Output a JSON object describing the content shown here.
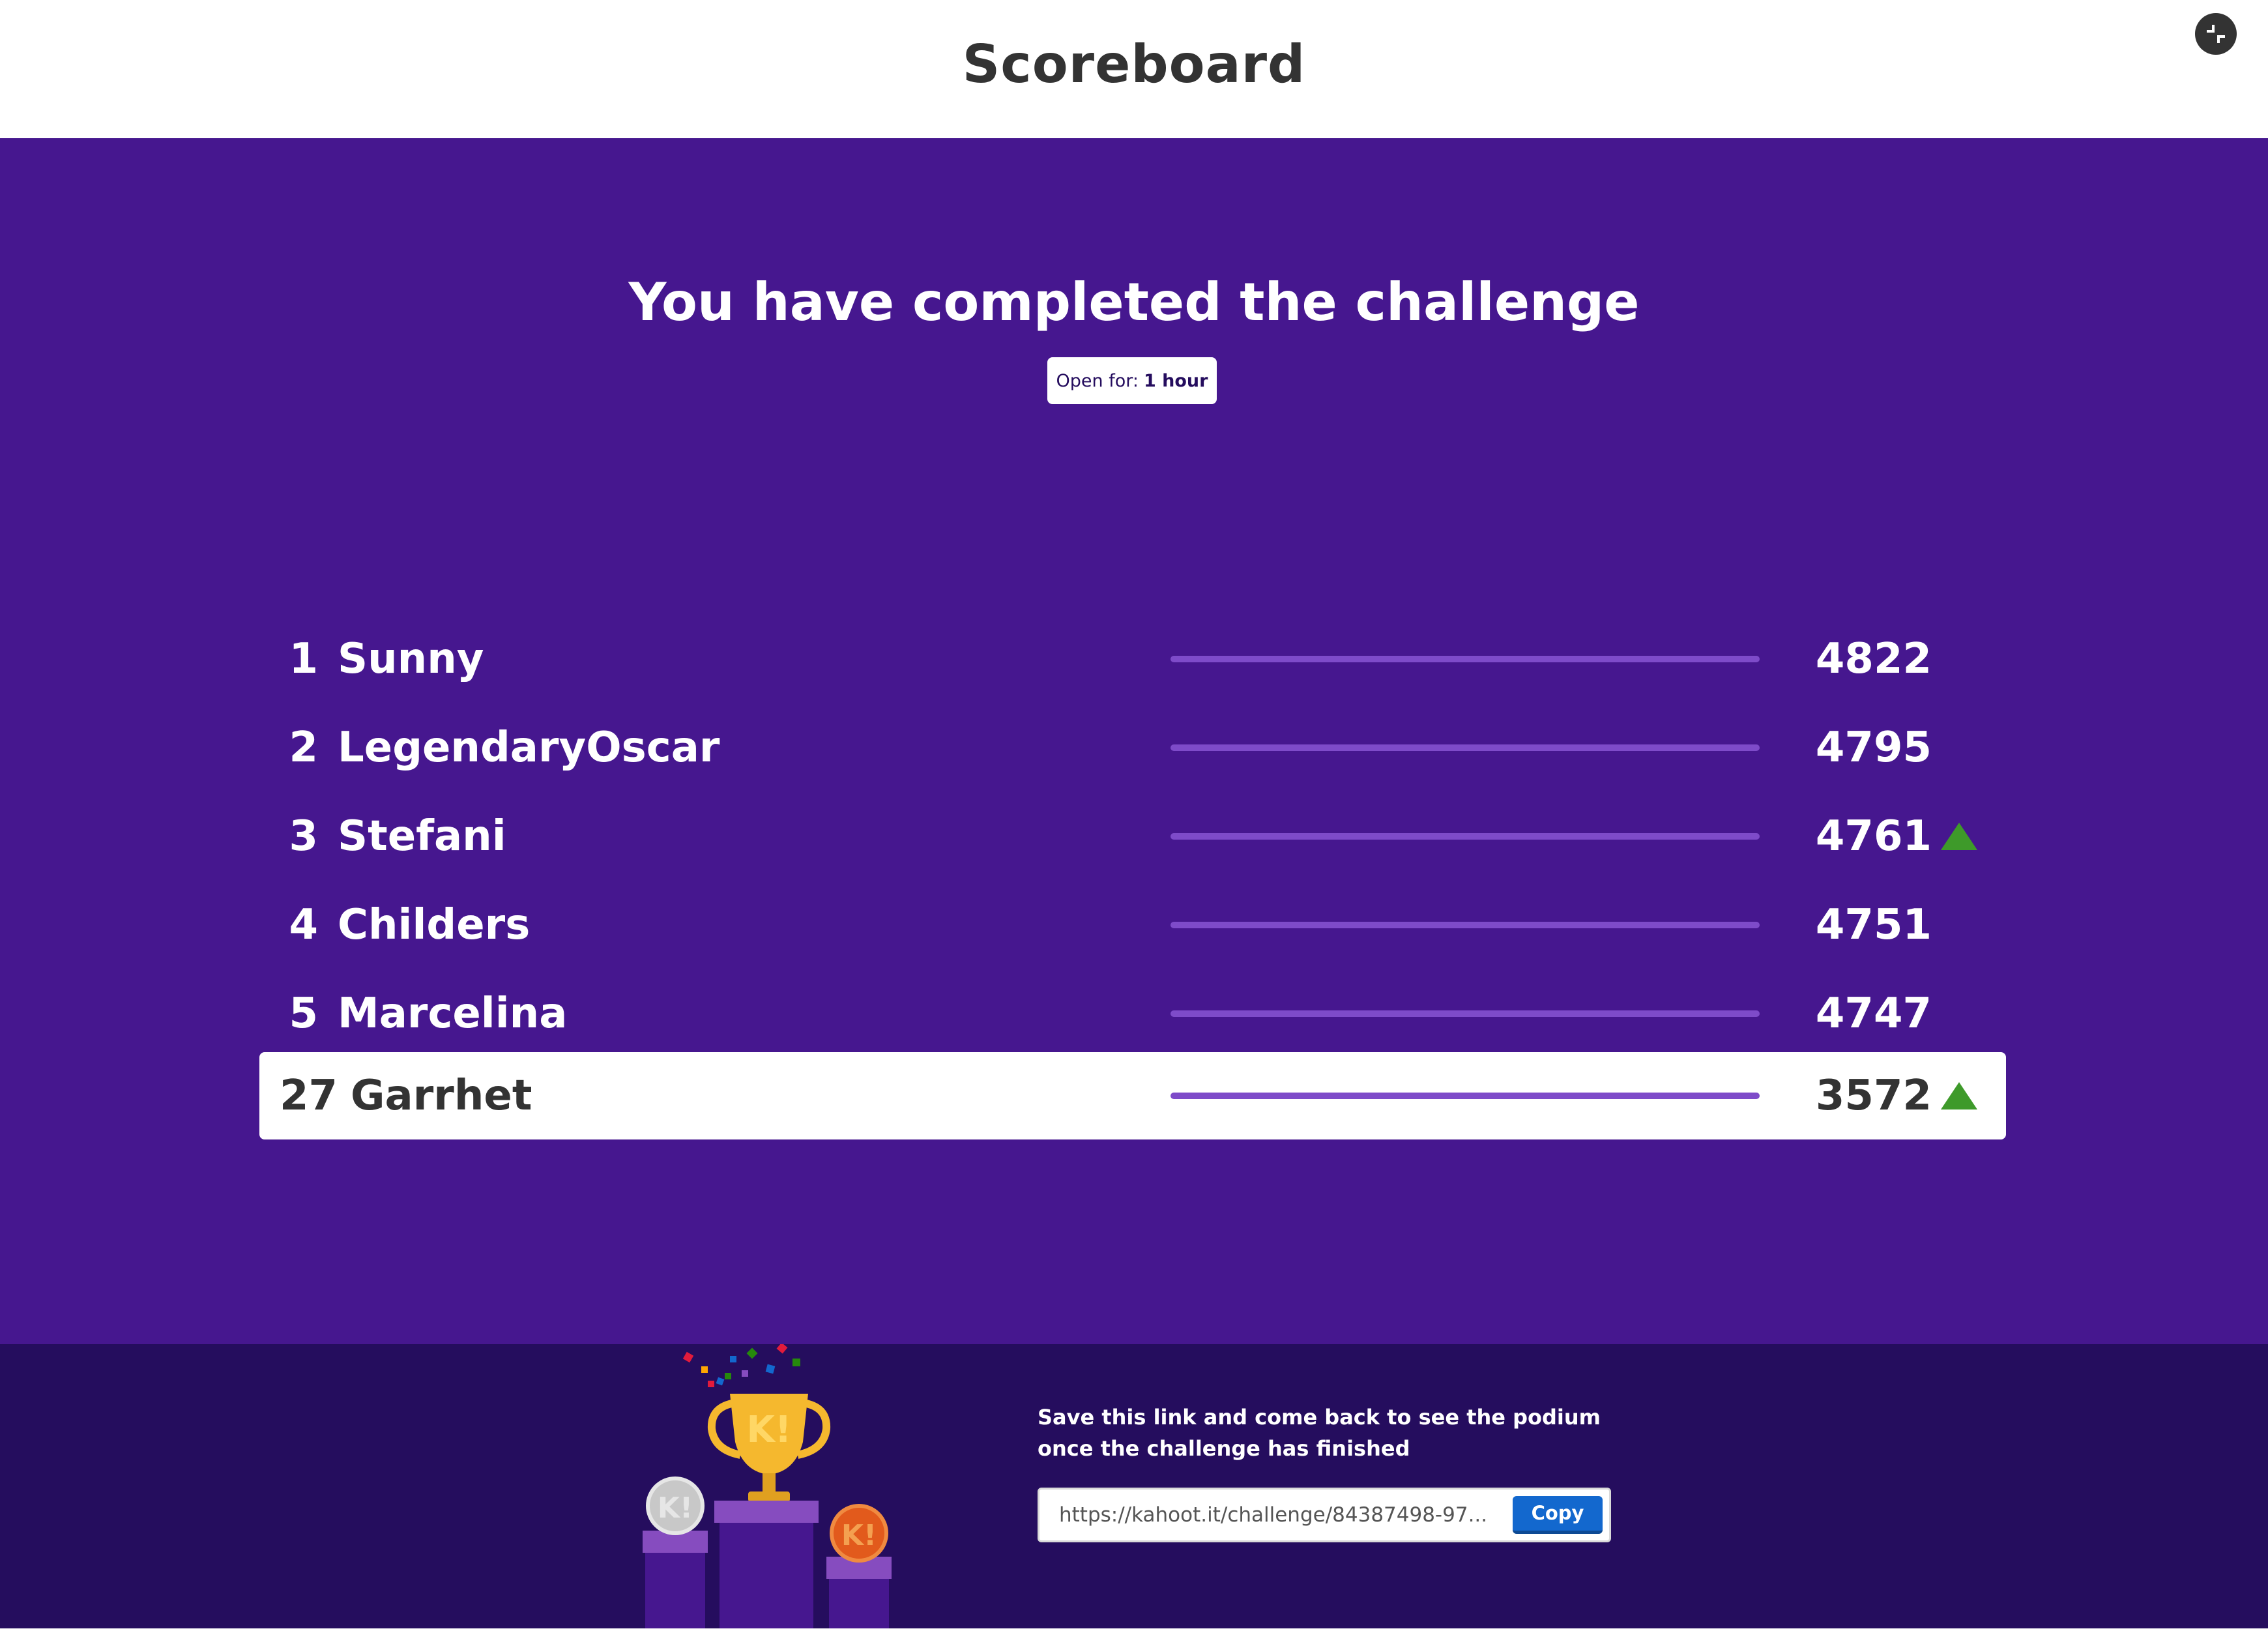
{
  "header": {
    "title": "Scoreboard",
    "fullscreen_icon": "fullscreen-exit-icon"
  },
  "main": {
    "title": "You have completed the challenge",
    "open_for": {
      "label": "Open for:",
      "value": "1 hour"
    }
  },
  "leaderboard": [
    {
      "rank": "1",
      "name": "Sunny",
      "score": "4822",
      "trend": "none"
    },
    {
      "rank": "2",
      "name": "LegendaryOscar",
      "score": "4795",
      "trend": "none"
    },
    {
      "rank": "3",
      "name": "Stefani",
      "score": "4761",
      "trend": "up"
    },
    {
      "rank": "4",
      "name": "Childers",
      "score": "4751",
      "trend": "none"
    },
    {
      "rank": "5",
      "name": "Marcelina",
      "score": "4747",
      "trend": "none"
    },
    {
      "rank": "27",
      "name": "Garrhet",
      "score": "3572",
      "trend": "up",
      "is_current_player": true
    }
  ],
  "footer": {
    "message_line1": "Save this link and come back to see the podium",
    "message_line2": "once the challenge has finished",
    "link": "https://kahoot.it/challenge/84387498-97...",
    "copy_label": "Copy",
    "trophy_letter": "K!"
  },
  "colors": {
    "brand_purple": "#46178f",
    "footer_purple": "#250d5e",
    "bar_purple": "#7e4bc9",
    "up_green": "#3e9a2a",
    "copy_blue": "#1368ce"
  }
}
